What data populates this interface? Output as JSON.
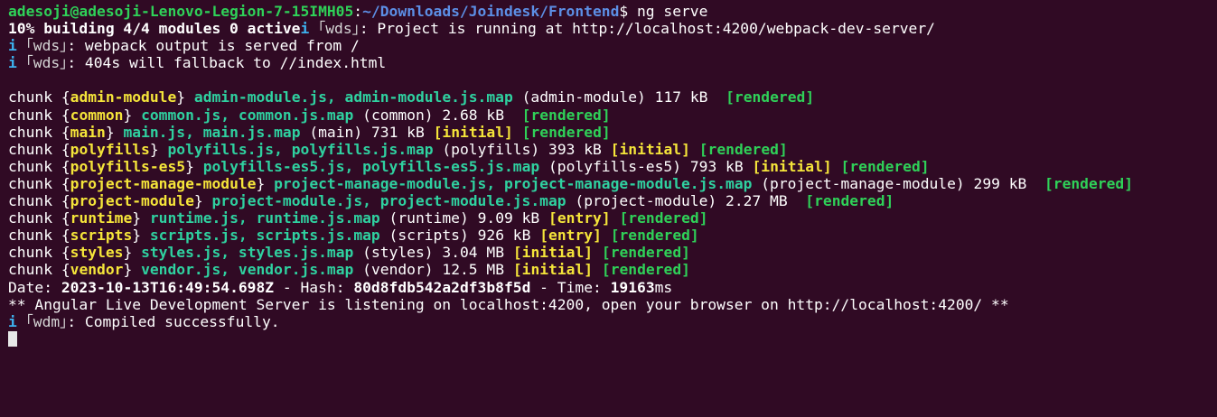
{
  "prompt": {
    "userhost": "adesoji@adesoji-Lenovo-Legion-7-15IMH05",
    "path": "~/Downloads/Joindesk/Frontend",
    "symbol": "$",
    "command": " ng serve"
  },
  "build": {
    "progress": "10% building 4/4 modules 0 active",
    "tag": "i",
    "wds_label": "｢wds｣",
    "running_msg": ": Project is running at http://localhost:4200/webpack-dev-server/",
    "served_msg": ": webpack output is served from /",
    "fallback_msg": ": 404s will fallback to //index.html"
  },
  "chunks": [
    {
      "name": "admin-module",
      "files": "admin-module.js, admin-module.js.map",
      "paren": "(admin-module)",
      "size": "117 kB",
      "tags": [
        "rendered"
      ]
    },
    {
      "name": "common",
      "files": "common.js, common.js.map",
      "paren": "(common)",
      "size": "2.68 kB",
      "tags": [
        "rendered"
      ]
    },
    {
      "name": "main",
      "files": "main.js, main.js.map",
      "paren": "(main)",
      "size": "731 kB",
      "tags": [
        "initial",
        "rendered"
      ]
    },
    {
      "name": "polyfills",
      "files": "polyfills.js, polyfills.js.map",
      "paren": "(polyfills)",
      "size": "393 kB",
      "tags": [
        "initial",
        "rendered"
      ]
    },
    {
      "name": "polyfills-es5",
      "files": "polyfills-es5.js, polyfills-es5.js.map",
      "paren": "(polyfills-es5)",
      "size": "793 kB",
      "tags": [
        "initial",
        "rendered"
      ]
    },
    {
      "name": "project-manage-module",
      "files": "project-manage-module.js, project-manage-module.js.map",
      "paren": "(project-manage-module)",
      "size": "299 kB",
      "tags": [
        "rendered"
      ]
    },
    {
      "name": "project-module",
      "files": "project-module.js, project-module.js.map",
      "paren": "(project-module)",
      "size": "2.27 MB",
      "tags": [
        "rendered"
      ]
    },
    {
      "name": "runtime",
      "files": "runtime.js, runtime.js.map",
      "paren": "(runtime)",
      "size": "9.09 kB",
      "tags": [
        "entry",
        "rendered"
      ]
    },
    {
      "name": "scripts",
      "files": "scripts.js, scripts.js.map",
      "paren": "(scripts)",
      "size": "926 kB",
      "tags": [
        "entry",
        "rendered"
      ]
    },
    {
      "name": "styles",
      "files": "styles.js, styles.js.map",
      "paren": "(styles)",
      "size": "3.04 MB",
      "tags": [
        "initial",
        "rendered"
      ]
    },
    {
      "name": "vendor",
      "files": "vendor.js, vendor.js.map",
      "paren": "(vendor)",
      "size": "12.5 MB",
      "tags": [
        "initial",
        "rendered"
      ]
    }
  ],
  "summary": {
    "date_label": "Date: ",
    "date": "2023-10-13T16:49:54.698Z",
    "hash_label": " - Hash: ",
    "hash": "80d8fdb542a2df3b8f5d",
    "time_label": " - Time: ",
    "time": "19163",
    "time_unit": "ms"
  },
  "server_msg": "** Angular Live Development Server is listening on localhost:4200, open your browser on http://localhost:4200/ **",
  "wdm": {
    "tag": "i",
    "label": "｢wdm｣",
    "msg": ": Compiled successfully."
  },
  "colors": {
    "background": "#300a24",
    "prompt_green": "#2fd158",
    "prompt_blue": "#5c8fe6",
    "chunk_name_yellow": "#f5e53a",
    "chunk_files_green": "#2fd1a0",
    "info_blue": "#3db2ef"
  }
}
